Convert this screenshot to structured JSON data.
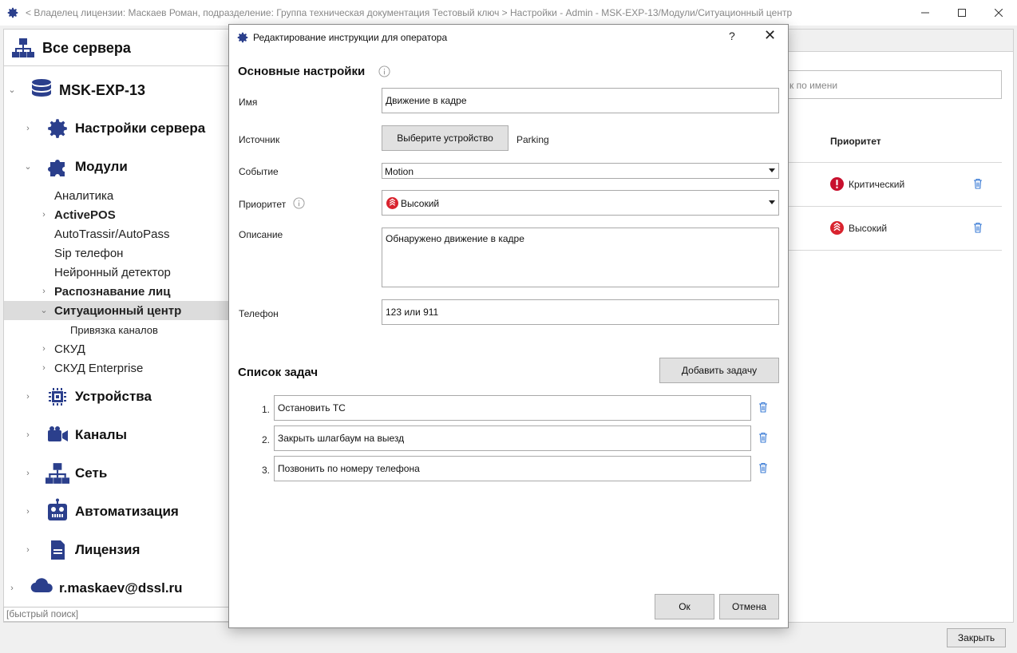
{
  "window": {
    "title": "< Владелец лицензии: Маскаев Роман, подразделение: Группа техническая документация Тестовый ключ > Настройки - Admin - MSK-EXP-13/Модули/Ситуационный центр",
    "minimize": "—",
    "maximize": "☐",
    "close": "✕"
  },
  "sidebar": {
    "all_servers": "Все сервера",
    "server": "MSK-EXP-13",
    "items": {
      "server_settings": "Настройки сервера",
      "modules": "Модули",
      "analytics": "Аналитика",
      "activepos": "ActivePOS",
      "autotrassir": "AutoTrassir/AutoPass",
      "sip": "Sip телефон",
      "neural": "Нейронный детектор",
      "face": "Распознавание лиц",
      "situation": "Ситуационный центр",
      "channel_binding": "Привязка каналов",
      "skud": "СКУД",
      "skud_ent": "СКУД Enterprise",
      "devices": "Устройства",
      "channels": "Каналы",
      "network": "Сеть",
      "automation": "Автоматизация",
      "license": "Лицензия"
    },
    "account": "r.maskaev@dssl.ru",
    "quick_search_placeholder": "[быстрый поиск]"
  },
  "right": {
    "search_placeholder": "к по имени",
    "priority_header": "Приоритет",
    "rows": [
      {
        "priority": "Критический",
        "color": "#c8102e"
      },
      {
        "priority": "Высокий",
        "color": "#d9232e"
      }
    ],
    "close_button": "Закрыть"
  },
  "dialog": {
    "title": "Редактирование инструкции для оператора",
    "help": "?",
    "close": "✕",
    "basic_settings": "Основные настройки",
    "name_label": "Имя",
    "name_value": "Движение в кадре",
    "source_label": "Источник",
    "source_button": "Выберите устройство",
    "source_value": "Parking",
    "event_label": "Событие",
    "event_value": "Motion",
    "priority_label": "Приоритет",
    "priority_value": "Высокий",
    "description_label": "Описание",
    "description_value": "Обнаружено движение в кадре",
    "phone_label": "Телефон",
    "phone_value": "123 или 911",
    "task_list_title": "Список задач",
    "add_task_button": "Добавить задачу",
    "tasks": [
      {
        "num": "1.",
        "text": "Остановить ТС"
      },
      {
        "num": "2.",
        "text": "Закрыть шлагбаум на выезд"
      },
      {
        "num": "3.",
        "text": "Позвонить по номеру телефона"
      }
    ],
    "ok_button": "Ок",
    "cancel_button": "Отмена"
  },
  "colors": {
    "accent_blue": "#2b3f8c",
    "trash_blue": "#3a7bd5",
    "critical_red": "#c8102e",
    "high_red": "#d9232e"
  }
}
